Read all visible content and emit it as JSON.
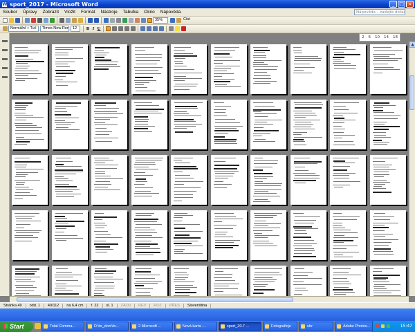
{
  "window": {
    "title": "sport_2017 - Microsoft Word"
  },
  "menu": [
    "Soubor",
    "Úpravy",
    "Zobrazit",
    "Vložit",
    "Formát",
    "Nástroje",
    "Tabulka",
    "Okno",
    "Nápověda"
  ],
  "help_placeholder": "Nápověda – zadejte dotaz",
  "toolbar": {
    "zoom": "35%",
    "read_label": "Číst",
    "style": "Normální + Tuč",
    "font": "Times New Roman",
    "size": "12"
  },
  "ruler": [
    "2",
    "6",
    "10",
    "14",
    "18"
  ],
  "pages": {
    "rows": 5,
    "cols": 10
  },
  "status": {
    "page": "Stránka 49",
    "section": "odd. 1",
    "pages": "49/112",
    "at": "na 6,4 cm",
    "line": "ř. 22",
    "col": "sl. 1",
    "modes": [
      "ZÁZN",
      "REV",
      "ROZ",
      "PŘES"
    ],
    "lang": "Slovenština"
  },
  "taskbar": {
    "start": "Start",
    "tasks": [
      "Total Comma...",
      "D:\\to_dom\\fo...",
      "2 Microsoft ...",
      "Nová karta -...",
      "sport_20.7 ...",
      "Fotograficje",
      "ubr",
      "Adobe Photos..."
    ],
    "active_index": 4,
    "clock": "15:47"
  },
  "colors": {
    "titlebar": "#0a3fc8",
    "taskbar": "#245edb",
    "start": "#3c9e3c",
    "doc_bg": "#808080"
  }
}
